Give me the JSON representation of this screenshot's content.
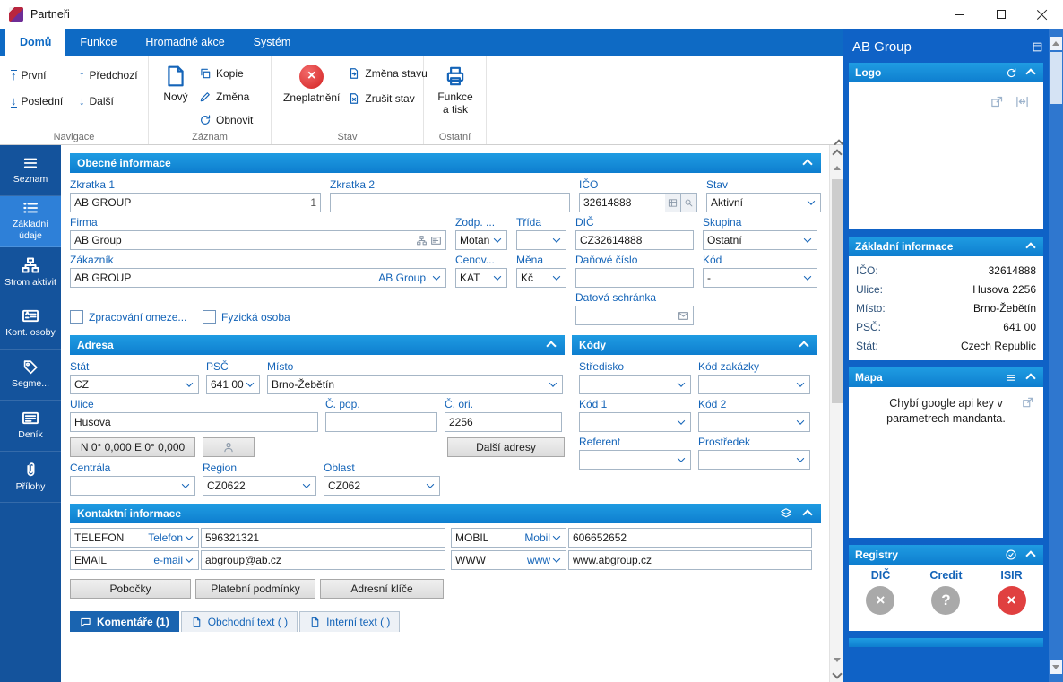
{
  "colors": {
    "ribbon_blue": "#0e6ac4",
    "sidebar_blue": "#14539c",
    "sidebar_active_blue": "#2e80d8",
    "section_header_blue": "#0f80d2",
    "label_blue": "#1464b8",
    "danger_red": "#d32222"
  },
  "titlebar": {
    "title": "Partneři"
  },
  "ribbon": {
    "tabs": [
      {
        "label": "Domů"
      },
      {
        "label": "Funkce"
      },
      {
        "label": "Hromadné akce"
      },
      {
        "label": "Systém"
      }
    ],
    "nav": {
      "group": "Navigace",
      "first": "První",
      "last": "Poslední",
      "prev": "Předchozí",
      "next": "Další"
    },
    "record": {
      "group": "Záznam",
      "new": "Nový",
      "copy": "Kopie",
      "edit": "Změna",
      "refresh": "Obnovit"
    },
    "state": {
      "group": "Stav",
      "invalidate": "Zneplatnění",
      "change": "Změna stavu",
      "cancel": "Zrušit stav"
    },
    "other": {
      "group": "Ostatní",
      "functions": "Funkce a tisk"
    }
  },
  "sidebar": {
    "items": [
      {
        "label": "Seznam"
      },
      {
        "label": "Základní údaje"
      },
      {
        "label": "Strom aktivit"
      },
      {
        "label": "Kont. osoby"
      },
      {
        "label": "Segme..."
      },
      {
        "label": "Deník"
      },
      {
        "label": "Přílohy"
      }
    ]
  },
  "general": {
    "title": "Obecné informace",
    "zkratka1": {
      "label": "Zkratka 1",
      "value": "AB GROUP",
      "badge": "1"
    },
    "zkratka2": {
      "label": "Zkratka 2",
      "value": ""
    },
    "ico": {
      "label": "IČO",
      "value": "32614888"
    },
    "stav": {
      "label": "Stav",
      "value": "Aktivní"
    },
    "firma": {
      "label": "Firma",
      "value": "AB Group"
    },
    "zodp": {
      "label": "Zodp. ...",
      "value": "Motan"
    },
    "trida": {
      "label": "Třída",
      "value": ""
    },
    "dic": {
      "label": "DIČ",
      "value": "CZ32614888"
    },
    "skupina": {
      "label": "Skupina",
      "value": "Ostatní"
    },
    "zakaznik": {
      "label": "Zákazník",
      "value": "AB GROUP",
      "link": "AB Group"
    },
    "cenova": {
      "label": "Cenov...",
      "value": "KAT"
    },
    "mena": {
      "label": "Měna",
      "value": "Kč"
    },
    "danove": {
      "label": "Daňové číslo",
      "value": ""
    },
    "kod": {
      "label": "Kód",
      "value": "-"
    },
    "check1": "Zpracování omeze...",
    "check2": "Fyzická osoba",
    "datovka": {
      "label": "Datová schránka",
      "value": ""
    }
  },
  "address": {
    "title": "Adresa",
    "stat": {
      "label": "Stát",
      "value": "CZ"
    },
    "psc": {
      "label": "PSČ",
      "value": "641 00"
    },
    "misto": {
      "label": "Místo",
      "value": "Brno-Žebětín"
    },
    "ulice": {
      "label": "Ulice",
      "value": "Husova"
    },
    "cpop": {
      "label": "Č. pop.",
      "value": ""
    },
    "cori": {
      "label": "Č. ori.",
      "value": "2256"
    },
    "gps": "N 0° 0,000 E 0° 0,000",
    "dalsi": "Další adresy",
    "centrala": {
      "label": "Centrála",
      "value": ""
    },
    "region": {
      "label": "Region",
      "value": "CZ0622"
    },
    "oblast": {
      "label": "Oblast",
      "value": "CZ062"
    }
  },
  "codes": {
    "title": "Kódy",
    "stredisko": {
      "label": "Středisko",
      "value": ""
    },
    "zakazka": {
      "label": "Kód zakázky",
      "value": ""
    },
    "kod1": {
      "label": "Kód 1",
      "value": ""
    },
    "kod2": {
      "label": "Kód 2",
      "value": ""
    },
    "referent": {
      "label": "Referent",
      "value": ""
    },
    "prostredek": {
      "label": "Prostředek",
      "value": ""
    }
  },
  "contacts": {
    "title": "Kontaktní informace",
    "rows": [
      {
        "type": "TELEFON",
        "kind": "Telefon",
        "value": "596321321"
      },
      {
        "type": "MOBIL",
        "kind": "Mobil",
        "value": "606652652"
      },
      {
        "type": "EMAIL",
        "kind": "e-mail",
        "value": "abgroup@ab.cz"
      },
      {
        "type": "WWW",
        "kind": "www",
        "value": "www.abgroup.cz"
      }
    ],
    "buttons": [
      {
        "label": "Pobočky"
      },
      {
        "label": "Platební podmínky"
      },
      {
        "label": "Adresní klíče"
      }
    ],
    "tabs": [
      {
        "label": "Komentáře (1)"
      },
      {
        "label": "Obchodní text ( )"
      },
      {
        "label": "Interní text ( )"
      }
    ]
  },
  "right": {
    "title": "AB Group",
    "logo": {
      "title": "Logo"
    },
    "info": {
      "title": "Základní informace",
      "rows": [
        {
          "label": "IČO:",
          "value": "32614888"
        },
        {
          "label": "Ulice:",
          "value": "Husova 2256"
        },
        {
          "label": "Místo:",
          "value": "Brno-Žebětín"
        },
        {
          "label": "PSČ:",
          "value": "641 00"
        },
        {
          "label": "Stát:",
          "value": "Czech Republic"
        }
      ]
    },
    "map": {
      "title": "Mapa",
      "message": "Chybí google api key v parametrech mandanta."
    },
    "registry": {
      "title": "Registry",
      "items": [
        {
          "label": "DIČ",
          "symbol": "×",
          "color": "#a9a9a9"
        },
        {
          "label": "Credit",
          "symbol": "?",
          "color": "#a9a9a9"
        },
        {
          "label": "ISIR",
          "symbol": "×",
          "color": "#e04040"
        }
      ]
    }
  }
}
